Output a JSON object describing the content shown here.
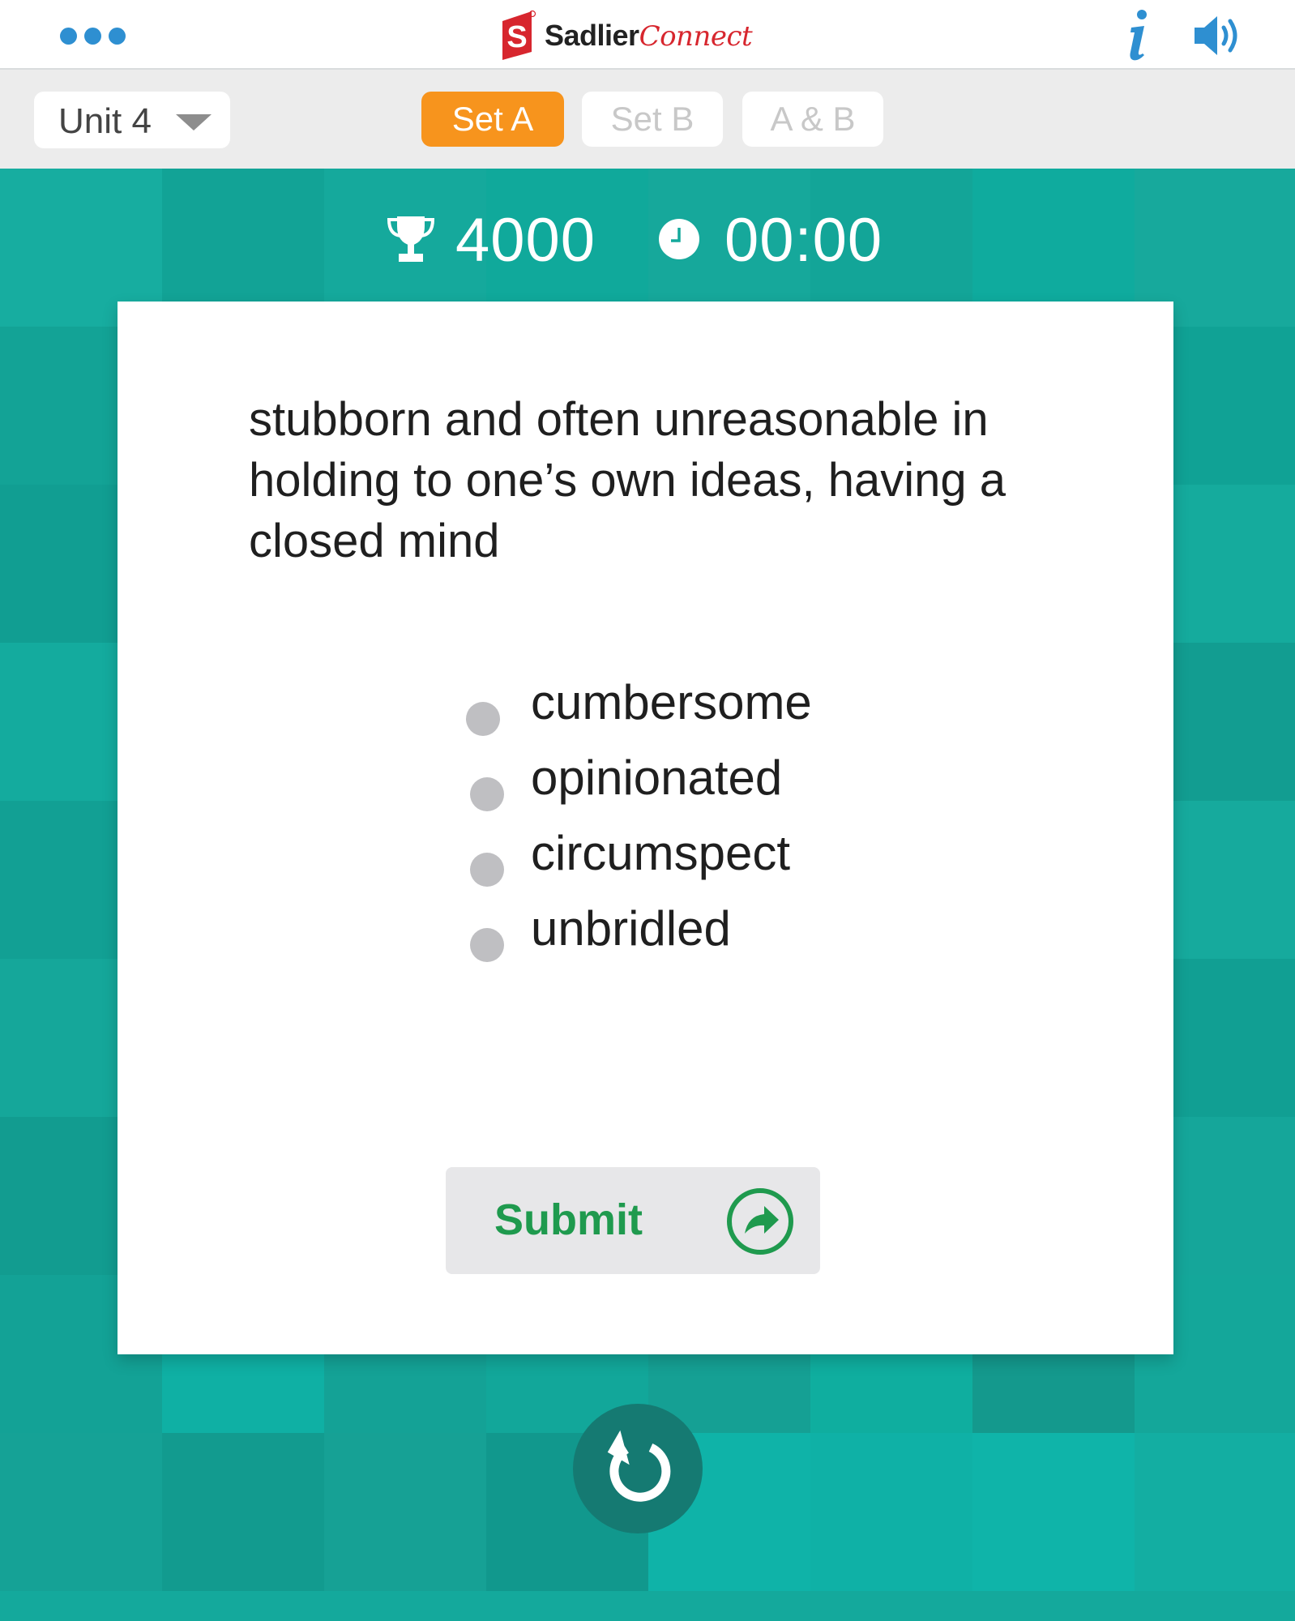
{
  "header": {
    "logo_brand": "Sadlier",
    "logo_product": "Connect",
    "logo_mark": "S",
    "menu_icon": "more-dots-icon",
    "info_icon": "info-icon",
    "sound_icon": "speaker-icon"
  },
  "toolbar": {
    "unit_select_value": "Unit 4",
    "sets": [
      "Set A",
      "Set B",
      "A & B"
    ],
    "active_set": "Set A"
  },
  "stats": {
    "score": "4000",
    "timer": "00:00"
  },
  "question": {
    "definition": "stubborn and often unreasonable in holding to one’s own ideas, having a closed mind",
    "options": [
      "cumbersome",
      "opinionated",
      "circumspect",
      "unbridled"
    ]
  },
  "actions": {
    "submit_label": "Submit",
    "reset_icon": "reset-icon"
  },
  "colors": {
    "brand_blue": "#2e8fd1",
    "brand_red": "#d7262e",
    "active_tab": "#f7941d",
    "background_teal": "#14a99c",
    "submit_green": "#1f9a4e",
    "reset_button": "#157a72"
  }
}
